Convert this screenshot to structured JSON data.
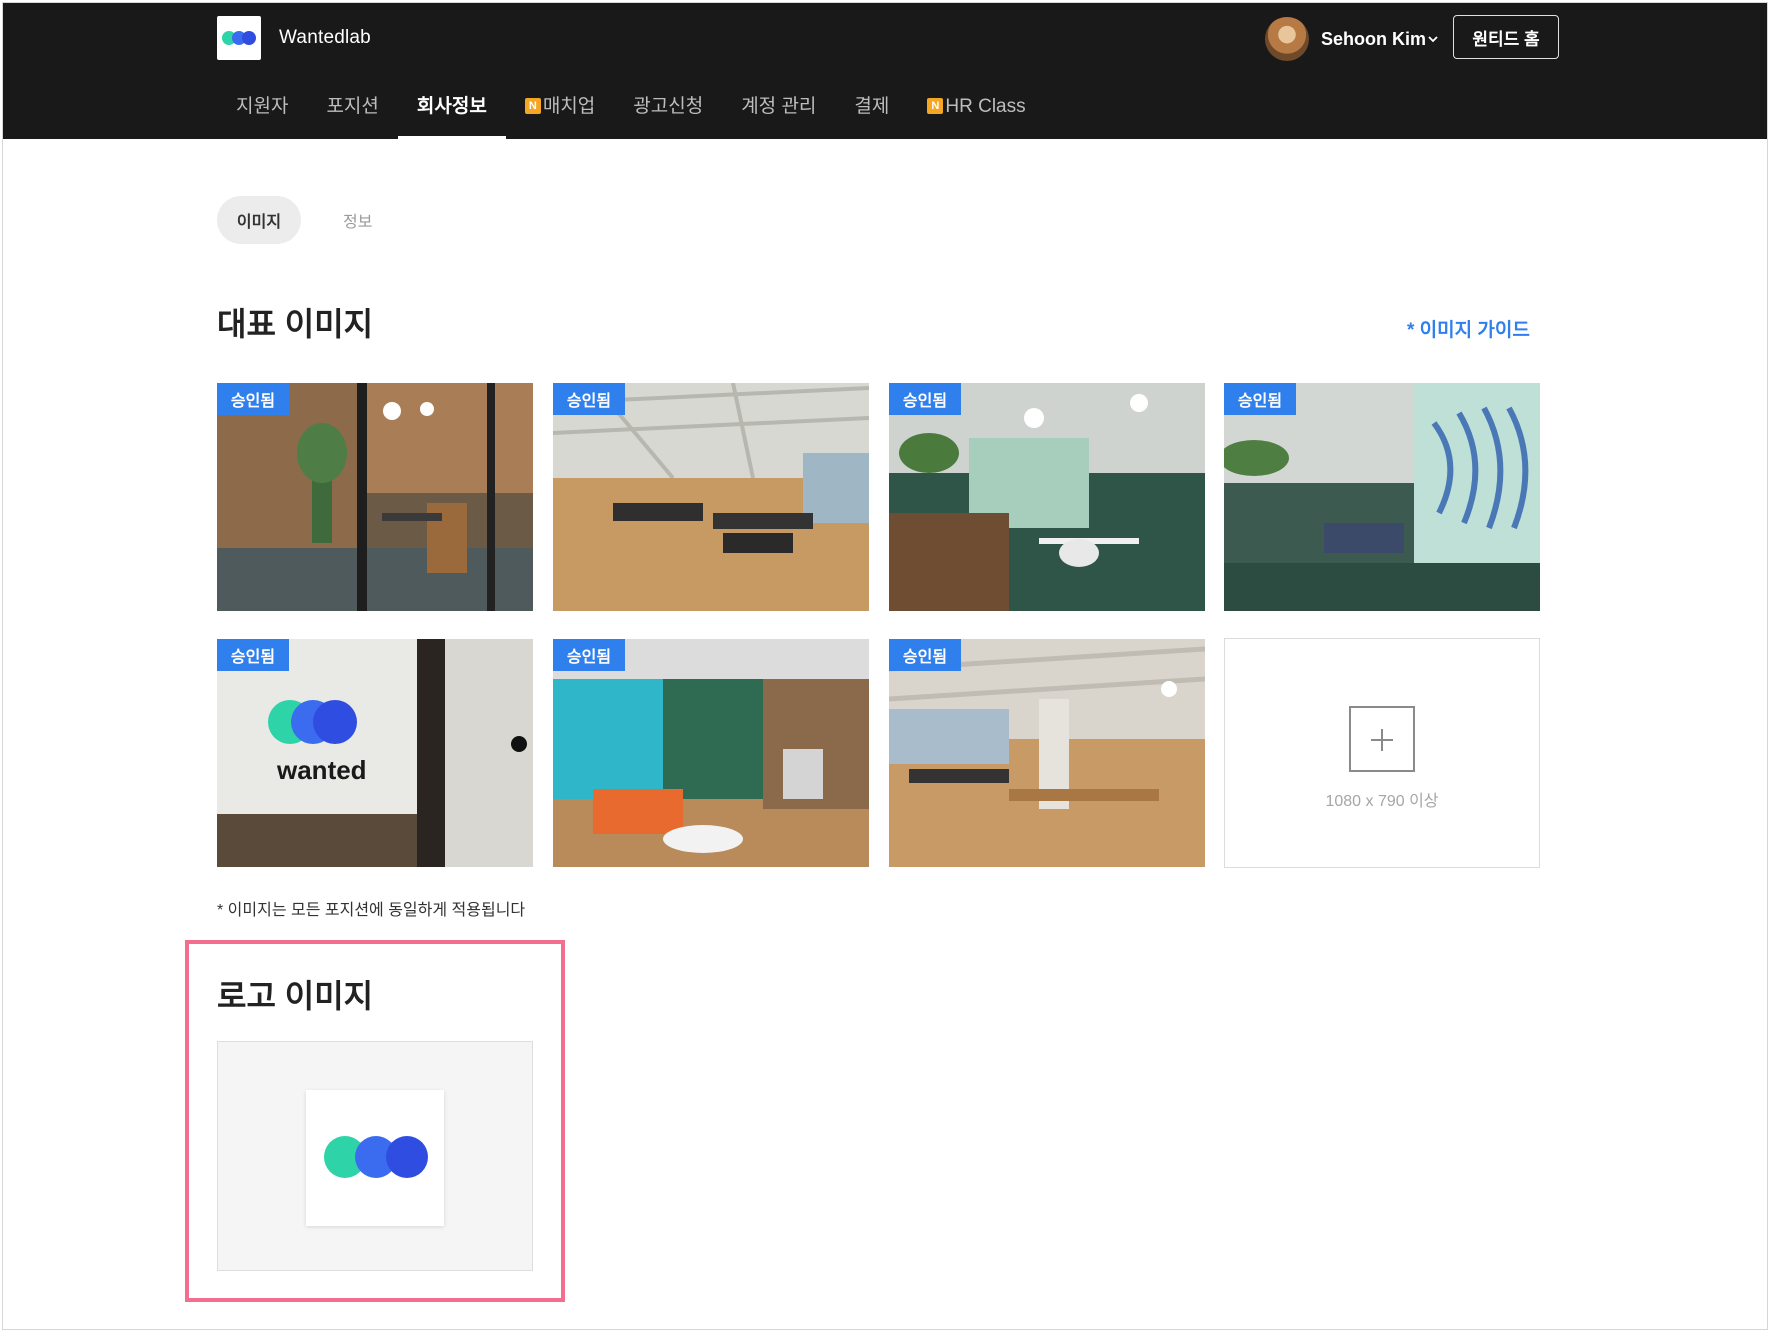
{
  "header": {
    "company_name": "Wantedlab",
    "user_name": "Sehoon Kim",
    "home_button": "원티드 홈",
    "nav": [
      {
        "label": "지원자",
        "badge": ""
      },
      {
        "label": "포지션",
        "badge": ""
      },
      {
        "label": "회사정보",
        "badge": "",
        "active": true
      },
      {
        "label": "매치업",
        "badge": "N"
      },
      {
        "label": "광고신청",
        "badge": ""
      },
      {
        "label": "계정 관리",
        "badge": ""
      },
      {
        "label": "결제",
        "badge": ""
      },
      {
        "label": "HR Class",
        "badge": "N"
      }
    ]
  },
  "subtabs": {
    "image": "이미지",
    "info": "정보"
  },
  "main_images": {
    "title": "대표 이미지",
    "guide_link": "* 이미지 가이드",
    "approved_label": "승인됨",
    "add_caption": "1080 x 790 이상",
    "note": "* 이미지는 모든 포지션에 동일하게 적용됩니다",
    "photo_wall_text": "wanted"
  },
  "logo_section": {
    "title": "로고 이미지"
  },
  "colors": {
    "header_bg": "#191919",
    "accent_blue": "#2f80ed",
    "highlight_border": "#f2708e",
    "logo_teal": "#2ed3a8",
    "logo_blue": "#3b6cf0",
    "logo_dark_blue": "#2f4de0"
  }
}
